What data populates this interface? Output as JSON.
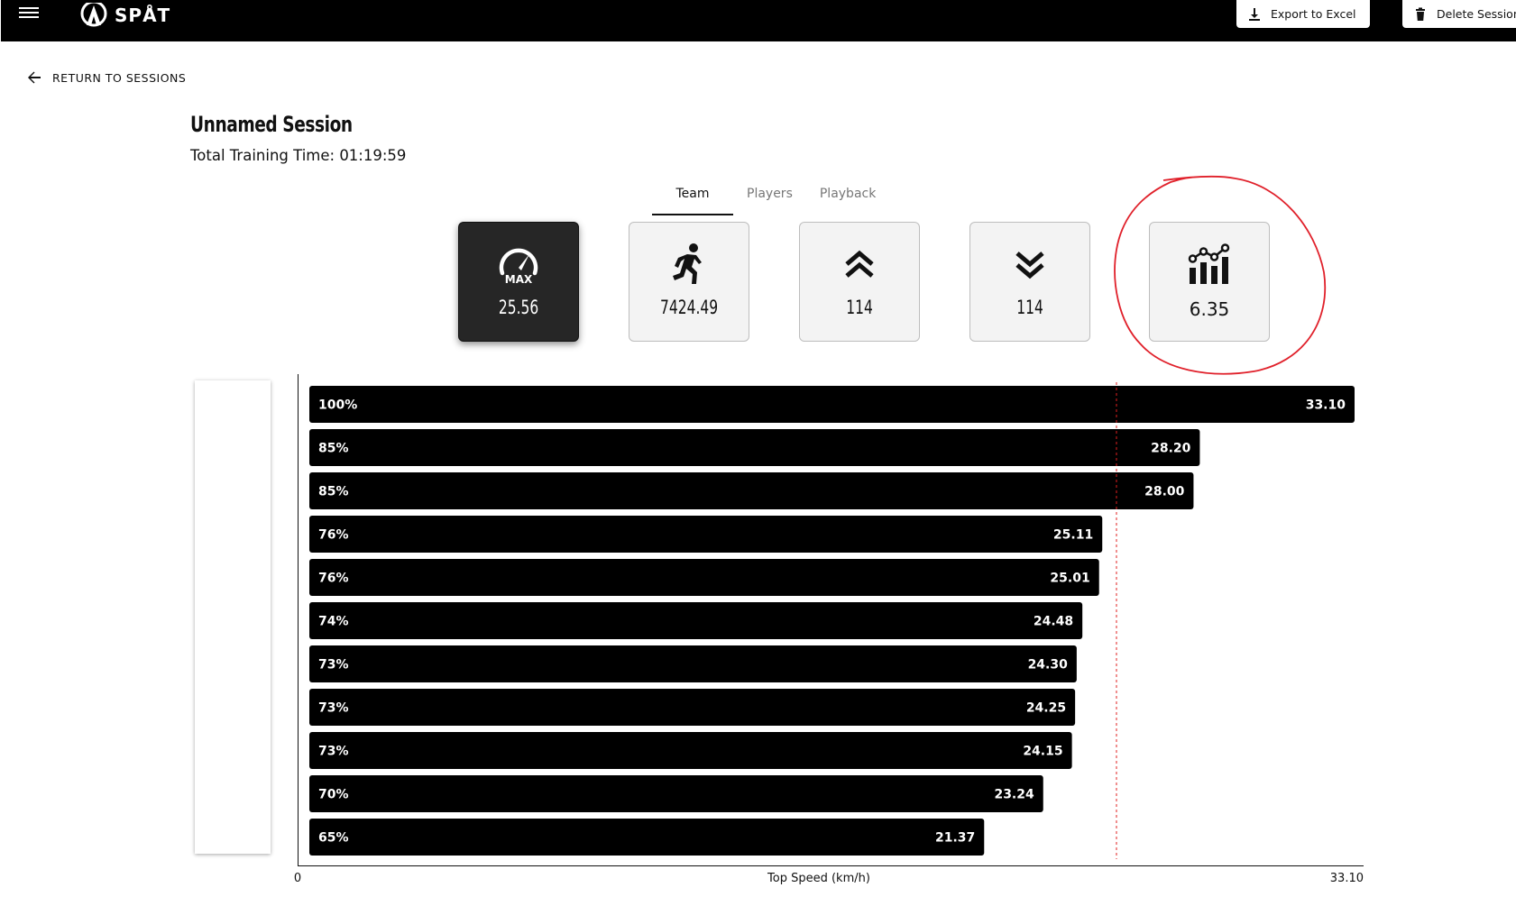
{
  "header": {
    "logo_text": "SPÅT",
    "export_label": "Export to Excel",
    "delete_label": "Delete Session"
  },
  "nav": {
    "return_label": "RETURN TO SESSIONS"
  },
  "session": {
    "title": "Unnamed Session",
    "training_time": "Total Training Time: 01:19:59"
  },
  "tabs": [
    {
      "label": "Team",
      "active": true
    },
    {
      "label": "Players",
      "active": false
    },
    {
      "label": "Playback",
      "active": false
    }
  ],
  "stats": [
    {
      "icon": "max-speed-gauge-icon",
      "value": "25.56",
      "selected": true
    },
    {
      "icon": "running-person-icon",
      "value": "7424.49",
      "selected": false
    },
    {
      "icon": "double-chevron-up-icon",
      "value": "114",
      "selected": false
    },
    {
      "icon": "double-chevron-down-icon",
      "value": "114",
      "selected": false
    },
    {
      "icon": "bar-line-chart-icon",
      "value": "6.35",
      "selected": false
    }
  ],
  "colors": {
    "topbar": "#000000",
    "selected_card": "#262626",
    "card": "#f3f3f3",
    "bar": "#000000",
    "reference_line": "#e02020",
    "annotation": "#e0202a"
  },
  "chart_data": {
    "type": "bar",
    "orientation": "horizontal",
    "xlabel": "Top Speed (km/h)",
    "xlim": [
      0,
      33.1
    ],
    "x_tick_labels": [
      "0",
      "33.10"
    ],
    "reference_line": 25.56,
    "bars": [
      {
        "percent": "100%",
        "value": 33.1,
        "value_label": "33.10"
      },
      {
        "percent": "85%",
        "value": 28.2,
        "value_label": "28.20"
      },
      {
        "percent": "85%",
        "value": 28.0,
        "value_label": "28.00"
      },
      {
        "percent": "76%",
        "value": 25.11,
        "value_label": "25.11"
      },
      {
        "percent": "76%",
        "value": 25.01,
        "value_label": "25.01"
      },
      {
        "percent": "74%",
        "value": 24.48,
        "value_label": "24.48"
      },
      {
        "percent": "73%",
        "value": 24.3,
        "value_label": "24.30"
      },
      {
        "percent": "73%",
        "value": 24.25,
        "value_label": "24.25"
      },
      {
        "percent": "73%",
        "value": 24.15,
        "value_label": "24.15"
      },
      {
        "percent": "70%",
        "value": 23.24,
        "value_label": "23.24"
      },
      {
        "percent": "65%",
        "value": 21.37,
        "value_label": "21.37"
      }
    ]
  }
}
